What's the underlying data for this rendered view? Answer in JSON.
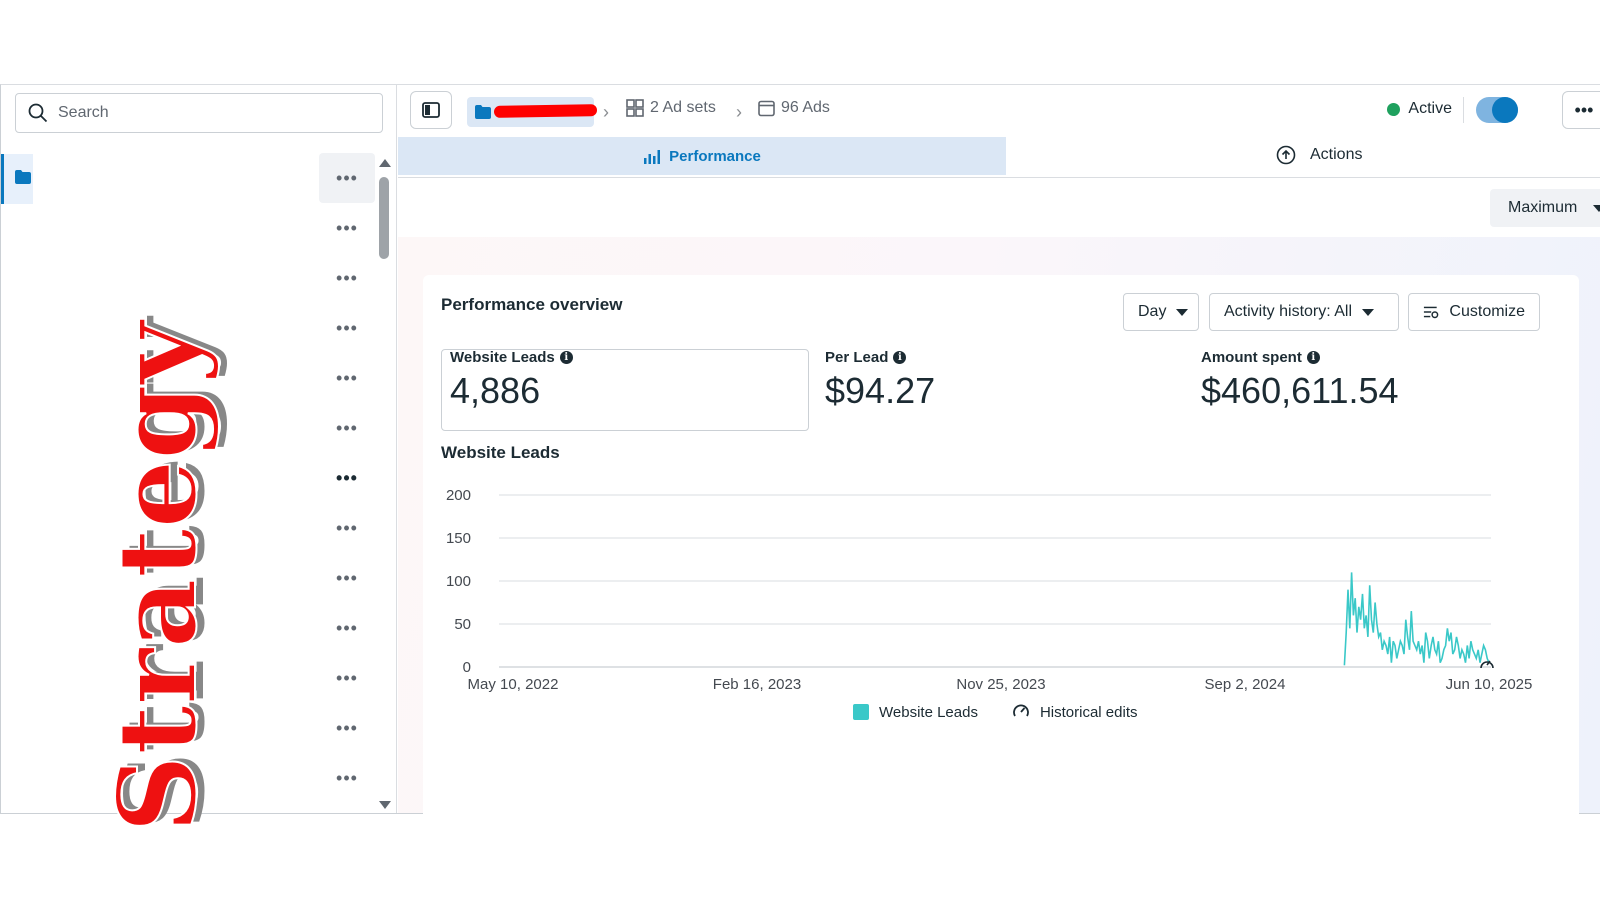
{
  "search": {
    "placeholder": "Search"
  },
  "stamp_text": "Strategy",
  "breadcrumb": {
    "ad_sets": "2 Ad sets",
    "ads": "96 Ads"
  },
  "status": {
    "label": "Active",
    "color": "#1fa15e"
  },
  "tabs": {
    "performance": "Performance",
    "actions": "Actions"
  },
  "attribution_select": "Maximum",
  "overview": {
    "title": "Performance overview",
    "period_select": "Day",
    "activity_select": "Activity history: All",
    "customize": "Customize"
  },
  "metrics": [
    {
      "label": "Website Leads",
      "value": "4,886"
    },
    {
      "label": "Per Lead",
      "value": "$94.27"
    },
    {
      "label": "Amount spent",
      "value": "$460,611.54"
    }
  ],
  "chart_data": {
    "type": "line",
    "title": "Website Leads",
    "y_ticks": [
      "200",
      "150",
      "100",
      "50",
      "0"
    ],
    "ylim": [
      0,
      200
    ],
    "x_ticks": [
      "May 10, 2022",
      "Feb 16, 2023",
      "Nov 25, 2023",
      "Sep 2, 2024",
      "Jun 10, 2025"
    ],
    "series": [
      {
        "name": "Website Leads",
        "color": "#3ac8c8",
        "x_start": "2024-12-25",
        "x_end": "2025-06-10",
        "values": [
          2,
          40,
          90,
          45,
          110,
          60,
          80,
          40,
          70,
          55,
          85,
          45,
          60,
          35,
          95,
          55,
          40,
          75,
          50,
          35,
          40,
          20,
          30,
          25,
          15,
          35,
          5,
          30,
          25,
          10,
          20,
          30,
          25,
          15,
          55,
          35,
          20,
          65,
          30,
          25,
          20,
          30,
          15,
          25,
          5,
          40,
          30,
          10,
          25,
          35,
          20,
          15,
          30,
          5,
          10,
          20,
          25,
          45,
          30,
          40,
          15,
          20,
          35,
          25,
          10,
          20,
          15,
          5,
          25,
          10,
          30,
          20,
          15,
          10,
          20,
          5,
          15,
          25,
          20,
          10,
          5
        ]
      }
    ],
    "legend": [
      "Website Leads",
      "Historical edits"
    ],
    "grid": true,
    "legend_position": "bottom"
  },
  "accent_color": "#0a78be"
}
